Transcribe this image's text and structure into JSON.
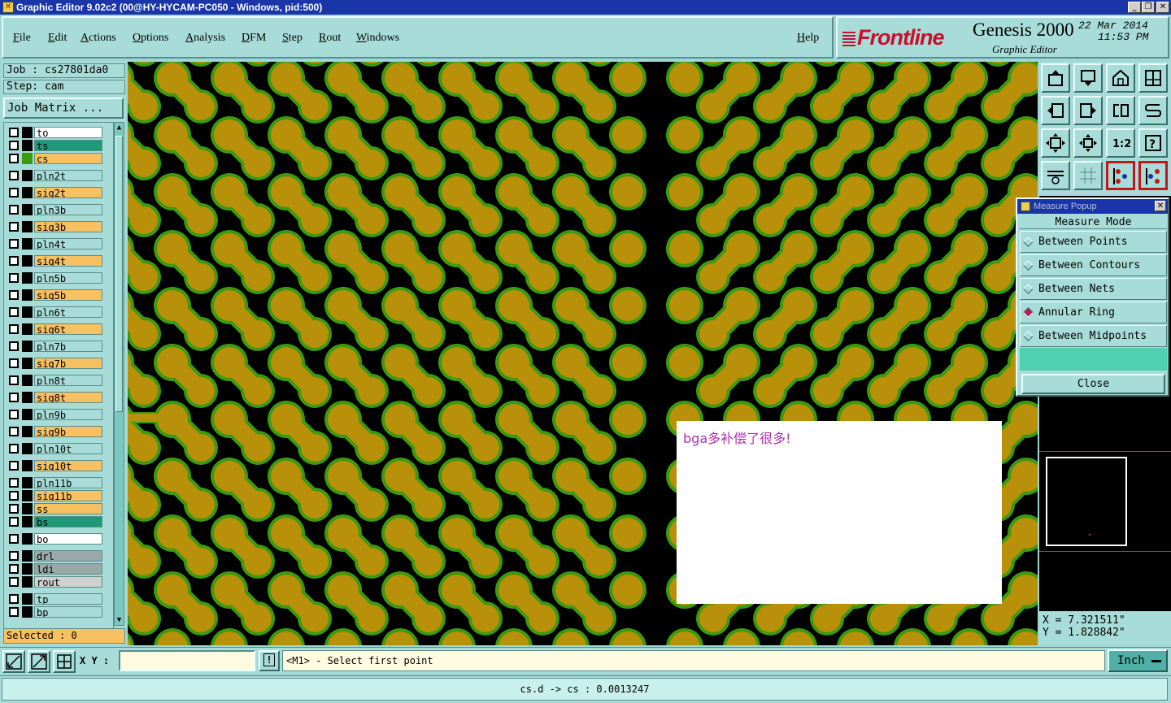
{
  "window": {
    "title": "Graphic Editor 9.02c2 (00@HY-HYCAM-PC050 - Windows, pid:500)",
    "buttons": [
      "_",
      "❐",
      "✕"
    ]
  },
  "menu": [
    "File",
    "Edit",
    "Actions",
    "Options",
    "Analysis",
    "DFM",
    "Step",
    "Rout",
    "Windows"
  ],
  "help_label": "Help",
  "brand": {
    "logo": "Frontline",
    "product": "Genesis 2000",
    "subtitle": "Graphic Editor",
    "date": "22 Mar 2014",
    "time": "11:53 PM"
  },
  "job": {
    "job_label": "Job : cs27801da0",
    "step_label": "Step: cam",
    "matrix_button": "Job Matrix ..."
  },
  "layers": [
    {
      "name": "to",
      "color": "#ffffff"
    },
    {
      "name": "ts",
      "color": "#1e9a7a"
    },
    {
      "name": "cs",
      "color": "#f7c060"
    },
    {
      "name": "pln2t",
      "color": "#a8dcd8"
    },
    {
      "name": "sig2t",
      "color": "#f7c060"
    },
    {
      "name": "pln3b",
      "color": "#a8dcd8"
    },
    {
      "name": "sig3b",
      "color": "#f7c060"
    },
    {
      "name": "pln4t",
      "color": "#a8dcd8"
    },
    {
      "name": "sig4t",
      "color": "#f7c060"
    },
    {
      "name": "pln5b",
      "color": "#a8dcd8"
    },
    {
      "name": "sig5b",
      "color": "#f7c060"
    },
    {
      "name": "pln6t",
      "color": "#a8dcd8"
    },
    {
      "name": "sig6t",
      "color": "#f7c060"
    },
    {
      "name": "pln7b",
      "color": "#a8dcd8"
    },
    {
      "name": "sig7b",
      "color": "#f7c060"
    },
    {
      "name": "pln8t",
      "color": "#a8dcd8"
    },
    {
      "name": "sig8t",
      "color": "#f7c060"
    },
    {
      "name": "pln9b",
      "color": "#a8dcd8"
    },
    {
      "name": "sig9b",
      "color": "#f7c060"
    },
    {
      "name": "pln10t",
      "color": "#a8dcd8"
    },
    {
      "name": "sig10t",
      "color": "#f7c060"
    },
    {
      "name": "pln11b",
      "color": "#a8dcd8"
    },
    {
      "name": "sig11b",
      "color": "#f7c060"
    },
    {
      "name": "ss",
      "color": "#f7c060"
    },
    {
      "name": "bs",
      "color": "#1e9a7a"
    },
    {
      "name": "bo",
      "color": "#ffffff"
    },
    {
      "name": "drl",
      "color": "#9aa8a8"
    },
    {
      "name": "ldi",
      "color": "#9aa8a8"
    },
    {
      "name": "rout",
      "color": "#d0d0d0"
    },
    {
      "name": "tp",
      "color": "#a8dcd8"
    },
    {
      "name": "bp",
      "color": "#a8dcd8"
    }
  ],
  "selected_label": "Selected : 0",
  "note_text": "bga多补偿了很多!",
  "toolbar_icons": [
    "move-up-icon",
    "move-down-icon",
    "home-icon",
    "split-view-icon",
    "move-left-icon",
    "move-right-icon",
    "rotate-icon",
    "snake-icon",
    "zoom-fit-icon",
    "zoom-center-icon",
    "scale-1-2-icon",
    "help-icon",
    "tools-icon",
    "grid-icon",
    "layers-icon",
    "layers-alt-icon"
  ],
  "measure": {
    "title": "Measure Popup",
    "mode_label": "Measure Mode",
    "options": [
      {
        "label": "Between Points",
        "selected": false
      },
      {
        "label": "Between Contours",
        "selected": false
      },
      {
        "label": "Between Nets",
        "selected": false
      },
      {
        "label": "Annular Ring",
        "selected": true
      },
      {
        "label": "Between Midpoints",
        "selected": false
      }
    ],
    "close_label": "Close"
  },
  "coords": {
    "x": "X = 7.321511\"",
    "y": "Y = 1.828842\""
  },
  "bottom": {
    "xy_label": "X Y :",
    "xy_value": "",
    "excl_label": "!",
    "prompt": "<M1> - Select first point",
    "unit": "Inch"
  },
  "status_text": "cs.d -> cs : 0.0013247",
  "colors": {
    "pad": "#b8900a",
    "pad_ring": "#3c9a10",
    "background": "#000000",
    "panel": "#a8dcd8",
    "title_bar": "#1a35a8"
  }
}
